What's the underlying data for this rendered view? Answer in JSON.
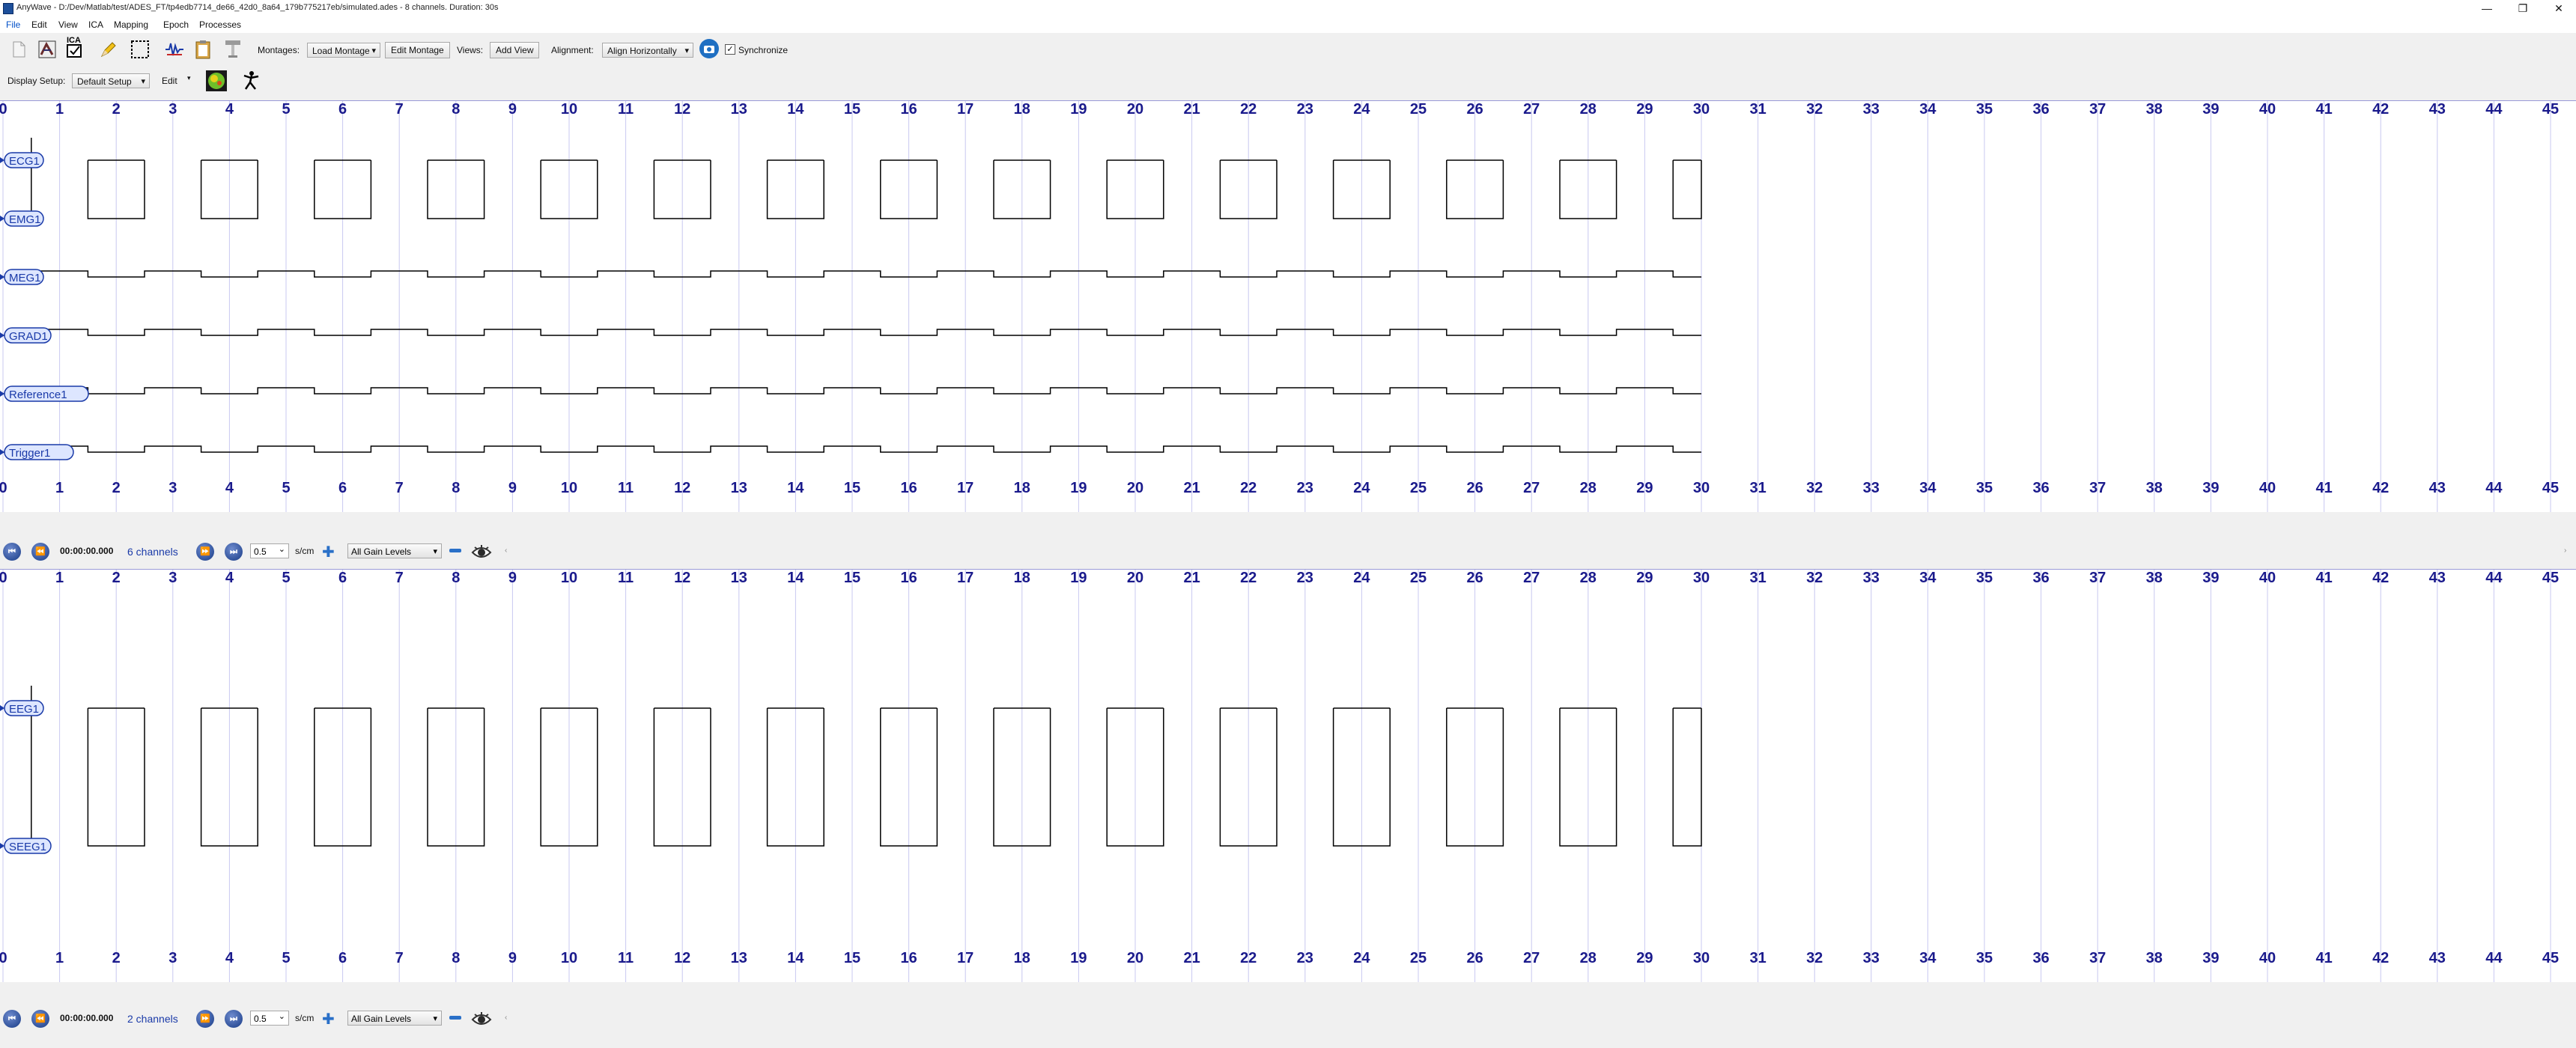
{
  "window": {
    "title": "AnyWave - D:/Dev/Matlab/test/ADES_FT/tp4edb7714_de66_42d0_8a64_179b775217eb/simulated.ades - 8 channels. Duration: 30s",
    "minimize": "—",
    "restore": "❐",
    "close": "✕"
  },
  "menu": [
    "File",
    "Edit",
    "View",
    "ICA",
    "Mapping",
    "Epoch",
    "Processes"
  ],
  "toolbar": {
    "montages_label": "Montages:",
    "load_montage": "Load Montage",
    "edit_montage": "Edit Montage",
    "views_label": "Views:",
    "add_view": "Add View",
    "alignment_label": "Alignment:",
    "alignment_value": "Align Horizontally",
    "synchronize_label": "Synchronize",
    "synchronize_checked": true,
    "icons": [
      "open-file-icon",
      "sensor-layout-icon",
      "ica-icon",
      "marker-pencil-icon",
      "selection-rectangle-icon",
      "signal-filter-icon",
      "clipboard-icon",
      "microscope-icon",
      "camera-icon"
    ]
  },
  "toolbar2": {
    "display_setup_label": "Display Setup:",
    "display_setup_value": "Default Setup",
    "edit_label": "Edit",
    "icons": [
      "topography-map-icon",
      "dancer-icon"
    ]
  },
  "time_axis": {
    "start": 0,
    "end": 45,
    "ticks": [
      "0",
      "1",
      "2",
      "3",
      "4",
      "5",
      "6",
      "7",
      "8",
      "9",
      "10",
      "11",
      "12",
      "13",
      "14",
      "15",
      "16",
      "17",
      "18",
      "19",
      "20",
      "21",
      "22",
      "23",
      "24",
      "25",
      "26",
      "27",
      "28",
      "29",
      "30",
      "31",
      "32",
      "33",
      "34",
      "35",
      "36",
      "37",
      "38",
      "39",
      "40",
      "41",
      "42",
      "43",
      "44",
      "45"
    ],
    "unit": "s",
    "signal_duration": 30
  },
  "views": [
    {
      "channels": [
        {
          "name": "ECG1",
          "waveform": "square-large"
        },
        {
          "name": "EMG1",
          "waveform": "none"
        },
        {
          "name": "MEG1",
          "waveform": "square-small"
        },
        {
          "name": "GRAD1",
          "waveform": "square-small"
        },
        {
          "name": "Reference1",
          "waveform": "square-small"
        },
        {
          "name": "Trigger1",
          "waveform": "square-small"
        }
      ],
      "nav": {
        "time": "00:00:00.000",
        "channels_text": "6 channels",
        "scale_value": "0.5",
        "scale_unit": "s/cm",
        "gain": "All Gain Levels"
      }
    },
    {
      "channels": [
        {
          "name": "EEG1",
          "waveform": "square-large"
        },
        {
          "name": "SEEG1",
          "waveform": "none"
        }
      ],
      "nav": {
        "time": "00:00:00.000",
        "channels_text": "2 channels",
        "scale_value": "0.5",
        "scale_unit": "s/cm",
        "gain": "All Gain Levels"
      }
    }
  ],
  "colors": {
    "tick_label": "#1a1a8c",
    "grid": "#c8c8f0",
    "trace": "#000000",
    "channel_label": "#1a3aa8",
    "channel_label_bg": "#dde6ff"
  }
}
